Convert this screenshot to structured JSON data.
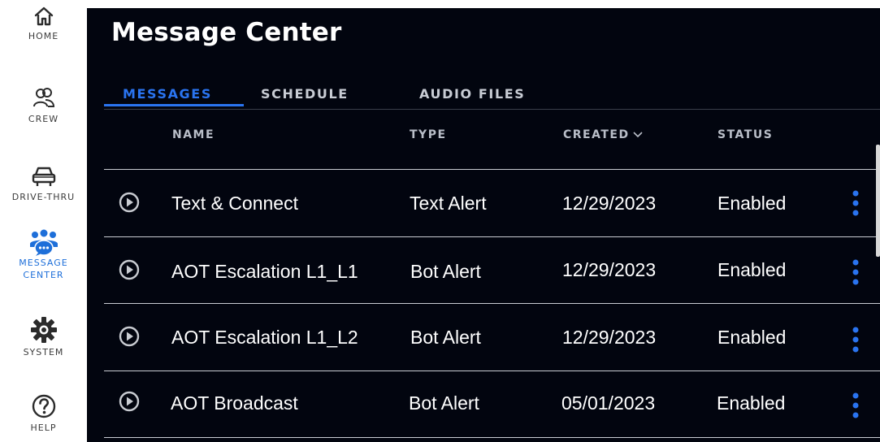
{
  "sidebar": {
    "items": [
      {
        "label": "HOME",
        "icon": "home-icon"
      },
      {
        "label": "CREW",
        "icon": "crew-icon"
      },
      {
        "label": "DRIVE-THRU",
        "icon": "car-icon"
      },
      {
        "label_line1": "MESSAGE",
        "label_line2": "CENTER",
        "icon": "message-center-icon"
      },
      {
        "label": "SYSTEM",
        "icon": "gear-icon"
      },
      {
        "label": "HELP",
        "icon": "help-icon"
      }
    ]
  },
  "main": {
    "title": "Message Center",
    "tabs": [
      {
        "label": "MESSAGES",
        "active": true
      },
      {
        "label": "SCHEDULE",
        "active": false
      },
      {
        "label": "AUDIO FILES",
        "active": false
      }
    ],
    "columns": {
      "name": "NAME",
      "type": "TYPE",
      "created": "CREATED",
      "status": "STATUS"
    },
    "rows": [
      {
        "name": "Text & Connect",
        "type": "Text Alert",
        "created": "12/29/2023",
        "status": "Enabled"
      },
      {
        "name": "AOT Escalation L1_L1",
        "type": "Bot Alert",
        "created": "12/29/2023",
        "status": "Enabled"
      },
      {
        "name": "AOT Escalation L1_L2",
        "type": "Bot Alert",
        "created": "12/29/2023",
        "status": "Enabled"
      },
      {
        "name": "AOT Broadcast",
        "type": "Bot Alert",
        "created": "05/01/2023",
        "status": "Enabled"
      }
    ]
  },
  "colors": {
    "accent": "#2a74f0",
    "panel_bg": "#02050f",
    "kebab": "#2a74f0"
  }
}
